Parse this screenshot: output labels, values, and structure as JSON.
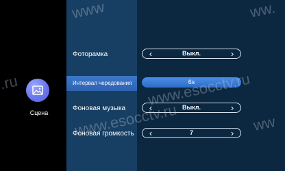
{
  "sidebar": {
    "items": [
      {
        "label": "Сцена",
        "icon": "picture-icon"
      }
    ]
  },
  "settings": [
    {
      "label": "Фоторамка",
      "value": "Выкл.",
      "selected": false
    },
    {
      "label": "Интервал чередования",
      "value": "6s",
      "selected": true
    },
    {
      "label": "Фоновая музыка",
      "value": "Выкл.",
      "selected": false
    },
    {
      "label": "Фоновая громкость",
      "value": "7",
      "selected": false
    }
  ],
  "arrows": {
    "prev": "‹",
    "next": "›"
  },
  "watermarks": [
    "www",
    "ww.",
    ".ru",
    "www.esocctv.ru",
    "www.esocctv.ru",
    "ww"
  ],
  "colors": {
    "background": "#0c2740",
    "menu_column": "#173f63",
    "selection": "#3d78c9",
    "active_value": "#3b7fd9",
    "icon_circle": "#6a76ee"
  }
}
